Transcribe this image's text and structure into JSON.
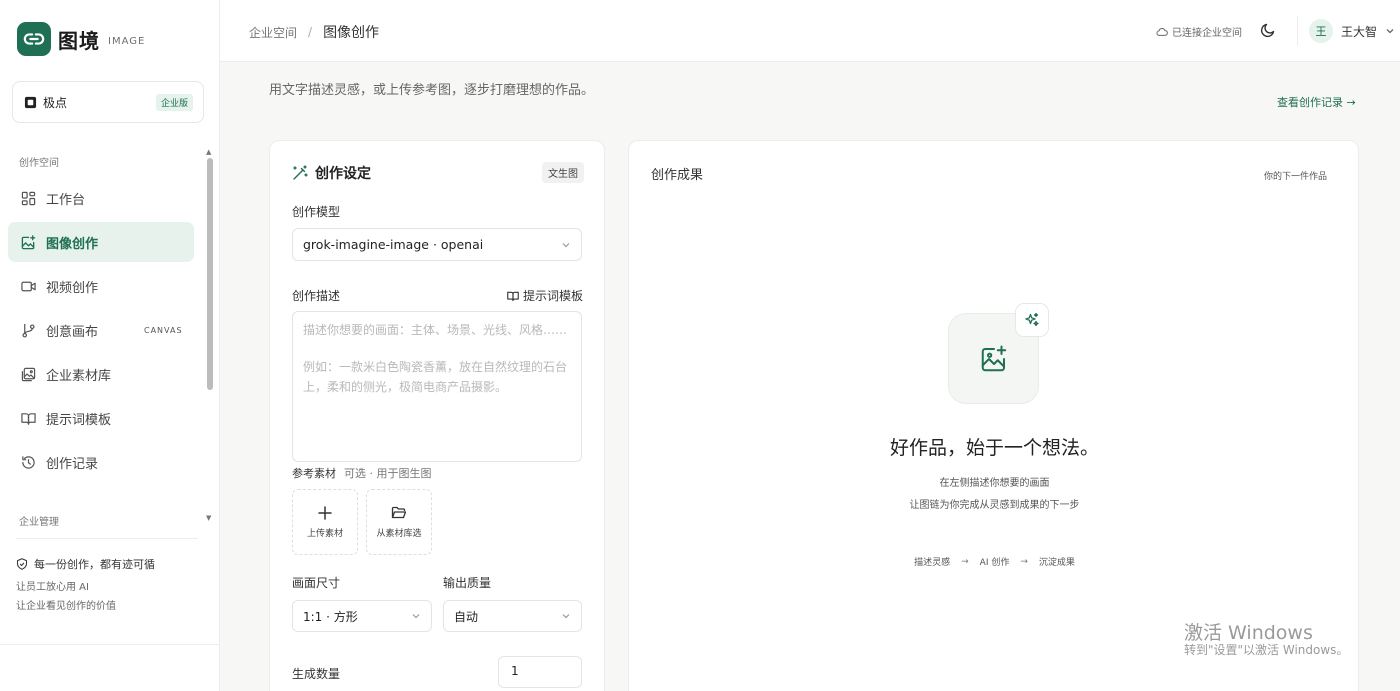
{
  "brand": {
    "name": "图境",
    "sub": "IMAGE"
  },
  "workspace": {
    "name": "极点",
    "badge": "企业版"
  },
  "nav": {
    "group_creation": "创作空间",
    "items": [
      {
        "label": "工作台",
        "icon": "dashboard-icon",
        "tag": ""
      },
      {
        "label": "图像创作",
        "icon": "image-plus-icon",
        "tag": ""
      },
      {
        "label": "视频创作",
        "icon": "video-icon",
        "tag": ""
      },
      {
        "label": "创意画布",
        "icon": "git-branch-icon",
        "tag": "CANVAS"
      },
      {
        "label": "企业素材库",
        "icon": "image-library-icon",
        "tag": ""
      },
      {
        "label": "提示词模板",
        "icon": "book-open-icon",
        "tag": ""
      },
      {
        "label": "创作记录",
        "icon": "history-icon",
        "tag": ""
      }
    ],
    "group_admin": "企业管理"
  },
  "trust": {
    "title": "每一份创作，都有迹可循",
    "line1": "让员工放心用 AI",
    "line2": "让企业看见创作的价值"
  },
  "header": {
    "breadcrumb_root": "企业空间",
    "breadcrumb_sep": "/",
    "breadcrumb_current": "图像创作",
    "connection_status": "已连接企业空间",
    "user_initial": "王",
    "user_name": "王大智"
  },
  "main": {
    "subtitle": "用文字描述灵感，或上传参考图，逐步打磨理想的作品。",
    "history_link": "查看创作记录 →"
  },
  "settings": {
    "title": "创作设定",
    "mode_badge": "文生图",
    "model_label": "创作模型",
    "model_value": "grok-imagine-image · openai",
    "desc_label": "创作描述",
    "template_link": "提示词模板",
    "desc_placeholder": "描述你想要的画面：主体、场景、光线、风格……",
    "desc_example": "例如：一款米白色陶瓷香薰，放在自然纹理的石台上，柔和的侧光，极简电商产品摄影。",
    "ref_label": "参考素材",
    "ref_note": "可选 · 用于图生图",
    "upload_label": "上传素材",
    "library_label": "从素材库选",
    "size_label": "画面尺寸",
    "size_value": "1:1 · 方形",
    "quality_label": "输出质量",
    "quality_value": "自动",
    "count_label": "生成数量",
    "count_value": "1"
  },
  "result": {
    "title": "创作成果",
    "subtitle": "你的下一件作品",
    "hero_title": "好作品，始于一个想法。",
    "hero_line1": "在左侧描述你想要的画面",
    "hero_line2": "让图链为你完成从灵感到成果的下一步",
    "step1": "描述灵感",
    "step2": "AI 创作",
    "step3": "沉淀成果",
    "arrow": "→"
  },
  "watermark": {
    "line1": "激活 Windows",
    "line2": "转到\"设置\"以激活 Windows。"
  },
  "colors": {
    "accent": "#1f6f55",
    "accent_soft": "#e7f2ec"
  }
}
